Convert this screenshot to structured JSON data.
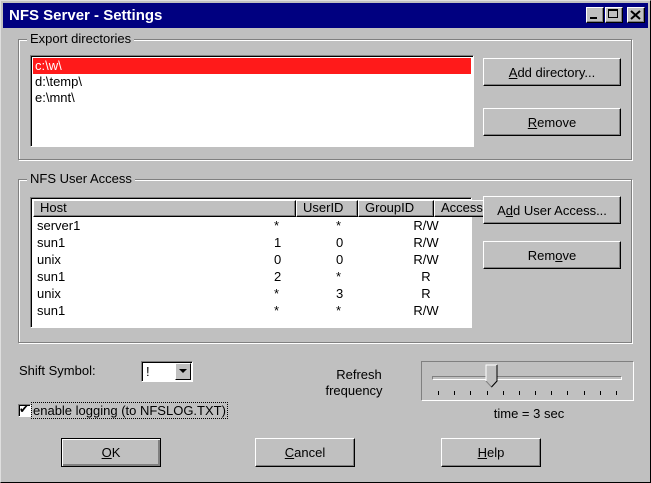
{
  "window": {
    "title": "NFS Server - Settings"
  },
  "export": {
    "legend": "Export directories",
    "items": [
      "c:\\w\\",
      "d:\\temp\\",
      "e:\\mnt\\"
    ],
    "selected_index": 0,
    "add_button": {
      "pre": "",
      "u": "A",
      "post": "dd directory..."
    },
    "remove_button": {
      "pre": "",
      "u": "R",
      "post": "emove"
    }
  },
  "access": {
    "legend": "NFS User Access",
    "columns": [
      "Host",
      "UserID",
      "GroupID",
      "Access"
    ],
    "rows": [
      [
        "server1",
        "*",
        "*",
        "R/W"
      ],
      [
        "sun1",
        "1",
        "0",
        "R/W"
      ],
      [
        "unix",
        "0",
        "0",
        "R/W"
      ],
      [
        "sun1",
        "2",
        "*",
        "R"
      ],
      [
        "unix",
        "*",
        "3",
        "R"
      ],
      [
        "sun1",
        "*",
        "*",
        "R/W"
      ]
    ],
    "add_button": {
      "pre": "A",
      "u": "d",
      "post": "d User Access..."
    },
    "remove_button": {
      "pre": "Rem",
      "u": "o",
      "post": "ve"
    }
  },
  "shift": {
    "label": "Shift Symbol:",
    "value": "!"
  },
  "refresh": {
    "label_line1": "Refresh",
    "label_line2": "frequency",
    "value_text": "time = 3 sec",
    "slider_fraction": 0.3,
    "tick_count": 12
  },
  "logging": {
    "label": "enable logging (to NFSLOG.TXT)",
    "checked": true,
    "check_glyph": "✔"
  },
  "buttons": {
    "ok": {
      "pre": "",
      "u": "O",
      "post": "K"
    },
    "cancel": {
      "pre": "",
      "u": "C",
      "post": "ancel"
    },
    "help": {
      "pre": "",
      "u": "H",
      "post": "elp"
    }
  },
  "colors": {
    "titlebar": "#000080",
    "selection": "#ff1a1a",
    "face": "#c0c0c0"
  },
  "icons": {
    "minimize": "minimize-icon",
    "maximize": "maximize-icon",
    "close": "close-icon",
    "dropdown": "chevron-down-icon",
    "check": "checkmark-icon"
  }
}
